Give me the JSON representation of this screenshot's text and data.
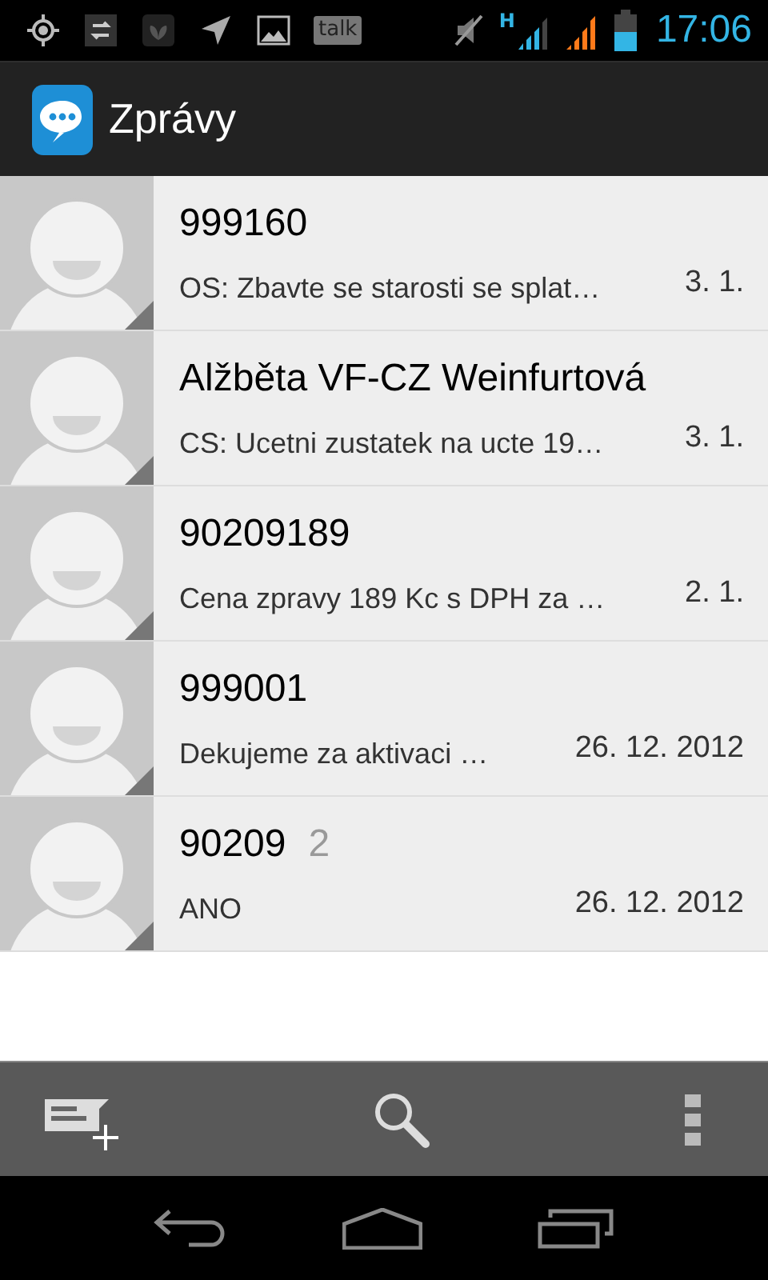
{
  "status_bar": {
    "talk_label": "talk",
    "network_label": "H",
    "time": "17:06"
  },
  "app_bar": {
    "title": "Zprávy"
  },
  "conversations": [
    {
      "name": "999160",
      "snippet": "OS: Zbavte se starosti se splat…",
      "date": "3. 1."
    },
    {
      "name": "Alžběta VF-CZ Weinfurtová",
      "snippet": "CS: Ucetni zustatek na ucte 19…",
      "date": "3. 1."
    },
    {
      "name": "90209189",
      "snippet": "Cena zpravy 189 Kc s DPH za …",
      "date": "2. 1."
    },
    {
      "name": "999001",
      "snippet": "Dekujeme za aktivaci …",
      "date": "26. 12. 2012"
    },
    {
      "name": "90209",
      "count": "2",
      "snippet": "ANO",
      "date": "26. 12. 2012"
    }
  ]
}
